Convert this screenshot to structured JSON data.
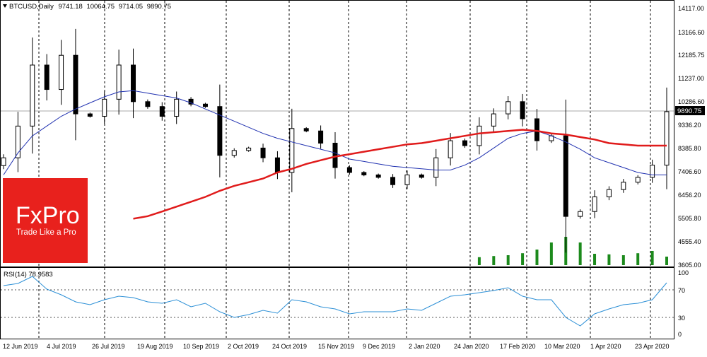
{
  "main_pane": {
    "header": {
      "symbol": "BTCUSD",
      "timeframe": "Daily",
      "ohlc": [
        "9741.18",
        "10064.75",
        "9714.05",
        "9890.75"
      ]
    },
    "price_axis": [
      "14117.00",
      "13166.60",
      "12185.75",
      "11237.00",
      "10286.60",
      "9336.20",
      "8385.80",
      "7406.60",
      "6456.20",
      "5505.80",
      "4555.40",
      "3605.00"
    ],
    "last_price": "9890.75"
  },
  "rsi_pane": {
    "label": "RSI(14) 78.9583",
    "levels": [
      "100",
      "70",
      "30",
      "0"
    ]
  },
  "x_axis": [
    "12 Jun 2019",
    "4 Jul 2019",
    "26 Jul 2019",
    "19 Aug 2019",
    "10 Sep 2019",
    "2 Oct 2019",
    "24 Oct 2019",
    "15 Nov 2019",
    "9 Dec 2019",
    "2 Jan 2020",
    "24 Jan 2020",
    "17 Feb 2020",
    "10 Mar 2020",
    "1 Apr 2020",
    "23 Apr 2020"
  ],
  "logo": {
    "brand": "FxPro",
    "tagline": "Trade Like a Pro",
    "color": "#e8211d"
  },
  "colors": {
    "candles": "#000000",
    "ma_fast": "#2031b0",
    "ma_slow": "#e01b1b",
    "rsi": "#2b8fd6",
    "volume": "#1c8a1c",
    "grid": "#000000"
  },
  "chart_data": {
    "type": "candlestick",
    "symbol": "BTCUSD",
    "timeframe": "Daily",
    "last_ohlc": {
      "open": 9741.18,
      "high": 10064.75,
      "low": 9714.05,
      "close": 9890.75
    },
    "y_range": [
      3605.0,
      14117.0
    ],
    "dates": [
      "2019-06-12",
      "2019-06-19",
      "2019-06-26",
      "2019-07-03",
      "2019-07-10",
      "2019-07-17",
      "2019-07-24",
      "2019-07-31",
      "2019-08-07",
      "2019-08-14",
      "2019-08-21",
      "2019-08-28",
      "2019-09-04",
      "2019-09-11",
      "2019-09-18",
      "2019-09-25",
      "2019-10-02",
      "2019-10-09",
      "2019-10-16",
      "2019-10-23",
      "2019-10-30",
      "2019-11-06",
      "2019-11-13",
      "2019-11-20",
      "2019-11-27",
      "2019-12-04",
      "2019-12-11",
      "2019-12-18",
      "2019-12-25",
      "2020-01-01",
      "2020-01-08",
      "2020-01-15",
      "2020-01-22",
      "2020-01-29",
      "2020-02-05",
      "2020-02-12",
      "2020-02-19",
      "2020-02-26",
      "2020-03-04",
      "2020-03-11",
      "2020-03-18",
      "2020-03-25",
      "2020-04-01",
      "2020-04-08",
      "2020-04-15",
      "2020-04-22",
      "2020-04-29"
    ],
    "close": [
      8000,
      9300,
      11800,
      10800,
      12200,
      9800,
      9700,
      10400,
      11800,
      10300,
      10100,
      9700,
      10400,
      10200,
      10100,
      8100,
      8300,
      8400,
      8000,
      7400,
      9200,
      9100,
      8600,
      7600,
      7400,
      7300,
      7200,
      6900,
      7300,
      7200,
      8000,
      8700,
      8500,
      9300,
      9800,
      10300,
      9600,
      8700,
      8900,
      5600,
      5800,
      6400,
      6700,
      7000,
      7200,
      7700,
      9890.75
    ],
    "ma_fast": [
      7300,
      8200,
      8900,
      9300,
      9700,
      10000,
      10250,
      10500,
      10700,
      10750,
      10650,
      10550,
      10450,
      10250,
      10000,
      9750,
      9500,
      9250,
      9000,
      8800,
      8650,
      8500,
      8350,
      8200,
      7950,
      7850,
      7750,
      7650,
      7600,
      7550,
      7500,
      7500,
      7700,
      8000,
      8400,
      8800,
      9000,
      9100,
      8900,
      8650,
      8350,
      8000,
      7800,
      7600,
      7400,
      7300,
      7300
    ],
    "ma_slow": [
      null,
      null,
      null,
      null,
      null,
      null,
      null,
      null,
      null,
      5505,
      5610,
      5800,
      6000,
      6200,
      6400,
      6650,
      6850,
      7000,
      7150,
      7400,
      7550,
      7750,
      7900,
      8050,
      8150,
      8250,
      8350,
      8450,
      8550,
      8600,
      8700,
      8800,
      8900,
      9000,
      9050,
      9100,
      9150,
      9100,
      9000,
      8950,
      8850,
      8750,
      8600,
      8550,
      8500,
      8500,
      8500
    ],
    "rsi": [
      75,
      78,
      88,
      70,
      62,
      52,
      48,
      55,
      60,
      58,
      52,
      50,
      55,
      45,
      50,
      38,
      30,
      34,
      40,
      36,
      55,
      52,
      45,
      42,
      35,
      38,
      38,
      38,
      42,
      40,
      50,
      60,
      62,
      65,
      68,
      72,
      60,
      55,
      55,
      30,
      18,
      35,
      42,
      48,
      50,
      55,
      78.96
    ],
    "rsi_levels": [
      70,
      30
    ],
    "rsi_range": [
      0,
      100
    ],
    "volume": [
      0,
      0,
      0,
      0,
      0,
      0,
      0,
      0,
      0,
      0,
      0,
      0,
      0,
      0,
      0,
      0,
      0,
      0,
      0,
      0,
      0,
      0,
      0,
      0,
      0,
      0,
      0,
      0,
      0,
      0,
      0,
      0,
      0,
      0.28,
      0.32,
      0.35,
      0.42,
      0.55,
      0.8,
      1.0,
      0.8,
      0.4,
      0.38,
      0.35,
      0.42,
      0.5,
      0.3
    ]
  }
}
